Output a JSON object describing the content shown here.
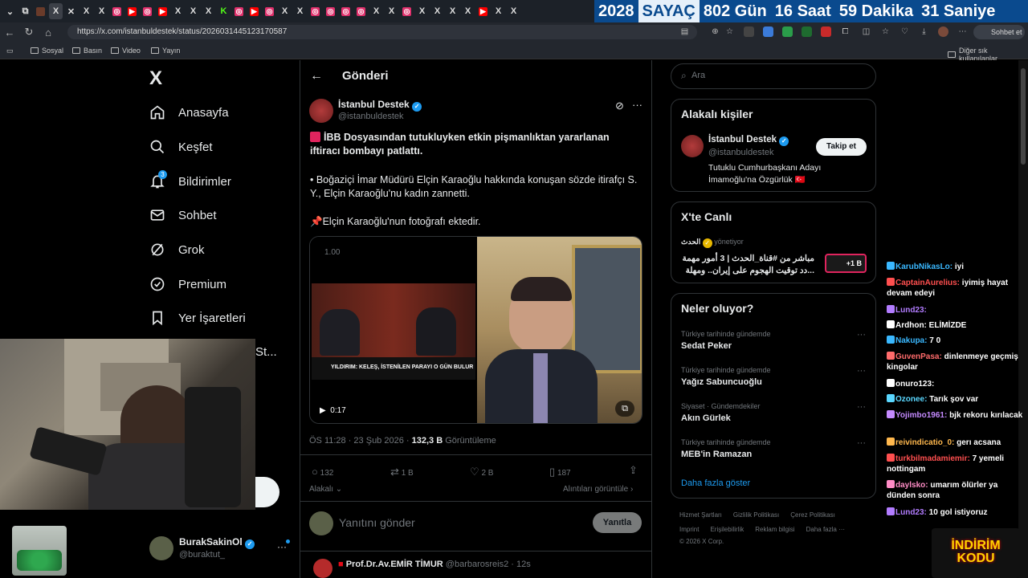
{
  "browser": {
    "tabs": [
      "X",
      "X",
      "K",
      "X",
      "X"
    ],
    "url": "https://x.com/istanbuldestek/status/2026031445123170587",
    "chat_button": "Sohbet et",
    "bookmarks": [
      "Sosyal",
      "Basın",
      "Video",
      "Yayın"
    ],
    "other_bookmarks": "Diğer sık kullanılanlar"
  },
  "counter": {
    "year": "2028",
    "label": "SAYAÇ",
    "days": "802 Gün",
    "hours": "16 Saat",
    "minutes": "59 Dakika",
    "seconds": "31 Saniye"
  },
  "leftnav": {
    "logo": "X",
    "items": [
      {
        "label": "Anasayfa",
        "icon": "home-icon"
      },
      {
        "label": "Keşfet",
        "icon": "search-icon"
      },
      {
        "label": "Bildirimler",
        "icon": "bell-icon",
        "badge": "3"
      },
      {
        "label": "Sohbet",
        "icon": "mail-icon"
      },
      {
        "label": "Grok",
        "icon": "grok-icon"
      },
      {
        "label": "Premium",
        "icon": "premium-icon"
      },
      {
        "label": "Yer İşaretleri",
        "icon": "bookmark-icon"
      }
    ],
    "partial_item": "St...",
    "account_name": "BurakSakinOl",
    "account_handle": "@buraktut_"
  },
  "post": {
    "header": "Gönderi",
    "author": "İstanbul Destek",
    "handle": "@istanbuldestek",
    "headline": "İBB Dosyasından tutukluyken etkin pişmanlıktan yararlanan iftiracı bombayı patlattı.",
    "para1": "• Boğaziçi İmar Müdürü Elçin Karaoğlu hakkında konuşan sözde itirafçı S. Y., Elçin Karaoğlu'nu kadın zannetti.",
    "para2": "Elçin Karaoğlu'nun fotoğrafı ektedir.",
    "video_speed": "1.00",
    "video_caption": "YILDIRIM: KELEŞ, İSTENİLEN PARAYI O GÜN BULUR",
    "video_time": "0:17",
    "time": "ÖS 11:28 · 23 Şub 2026 · ",
    "views": "132,3 B",
    "views_label": "Görüntüleme",
    "replies": "132",
    "reposts": "1 B",
    "likes": "2 B",
    "bookmarks": "187",
    "related": "Alakalı",
    "quotes": "Alıntıları görüntüle",
    "reply_placeholder": "Yanıtını gönder",
    "reply_button": "Yanıtla"
  },
  "next_reply": {
    "author": "Prof.Dr.Av.EMİR TİMUR",
    "handle": "@barbarosreis2",
    "time": "· 12s"
  },
  "right": {
    "search_placeholder": "Ara",
    "related_title": "Alakalı kişiler",
    "person_name": "İstanbul Destek",
    "person_handle": "@istanbuldestek",
    "follow": "Takip et",
    "bio": "Tutuklu Cumhurbaşkanı Adayı İmamoğlu'na Özgürlük 🇹🇷",
    "live_title": "X'te Canlı",
    "live_host": "الحدث",
    "live_status": "yönetiyor",
    "live_text1": "مباشر من #قناة_الحدث | 3 أمور مهمة",
    "live_text2": "...دد توقيت الهجوم على إيران.. ومهلة",
    "live_count": "+1 B",
    "trends_title": "Neler oluyor?",
    "trends": [
      {
        "cat": "Türkiye tarihinde gündemde",
        "name": "Sedat Peker"
      },
      {
        "cat": "Türkiye tarihinde gündemde",
        "name": "Yağız Sabuncuoğlu"
      },
      {
        "cat": "Siyaset · Gündemdekiler",
        "name": "Akın Gürlek"
      },
      {
        "cat": "Türkiye tarihinde gündemde",
        "name": "MEB'in Ramazan"
      }
    ],
    "show_more": "Daha fazla göster",
    "footer1": [
      "Hizmet Şartları",
      "Gizlilik Politikası",
      "Çerez Politikası"
    ],
    "footer2": [
      "Imprint",
      "Erişilebilirlik",
      "Reklam bilgisi",
      "Daha fazla ···"
    ],
    "copyright": "© 2026 X Corp."
  },
  "chat": [
    {
      "user": "KarubNikasLo:",
      "msg": "iyi",
      "color": "#3ab8ff"
    },
    {
      "user": "CaptainAurelius:",
      "msg": "iyimiş hayat devam edeyi",
      "color": "#ff4f4f"
    },
    {
      "user": "Lund23:",
      "msg": "",
      "color": "#b27cff"
    },
    {
      "user": "Ardhon:",
      "msg": "ELİMİZDE",
      "color": "#ffffff"
    },
    {
      "user": "Nakupa:",
      "msg": "7 0",
      "color": "#3ab8ff"
    },
    {
      "user": "GuvenPasa:",
      "msg": "dinlenmeye geçmiş kingolar",
      "color": "#ff6b6b"
    },
    {
      "user": "onuro123:",
      "msg": "",
      "color": "#ffffff"
    },
    {
      "user": "Ozonee:",
      "msg": "Tarık şov var",
      "color": "#5ad7ff"
    },
    {
      "user": "Yojimbo1961:",
      "msg": "bjk rekoru kırılacak",
      "color": "#c58bff"
    },
    {
      "user": "reivindicatio_0:",
      "msg": "gerı acsana",
      "color": "#ffb84d"
    },
    {
      "user": "turkbilmadamiemir:",
      "msg": "7 yemeli nottingam",
      "color": "#ff4f4f"
    },
    {
      "user": "daylsko:",
      "msg": "umarım ölürler ya dünden sonra",
      "color": "#ff8cc6"
    },
    {
      "user": "Lund23:",
      "msg": "10 gol istiyoruz",
      "color": "#b27cff"
    }
  ],
  "promo": "İNDİRİM KODU",
  "colors": {
    "accent": "#1d9bf0",
    "bg": "#000000",
    "border": "#2f3336",
    "muted": "#71767b"
  }
}
